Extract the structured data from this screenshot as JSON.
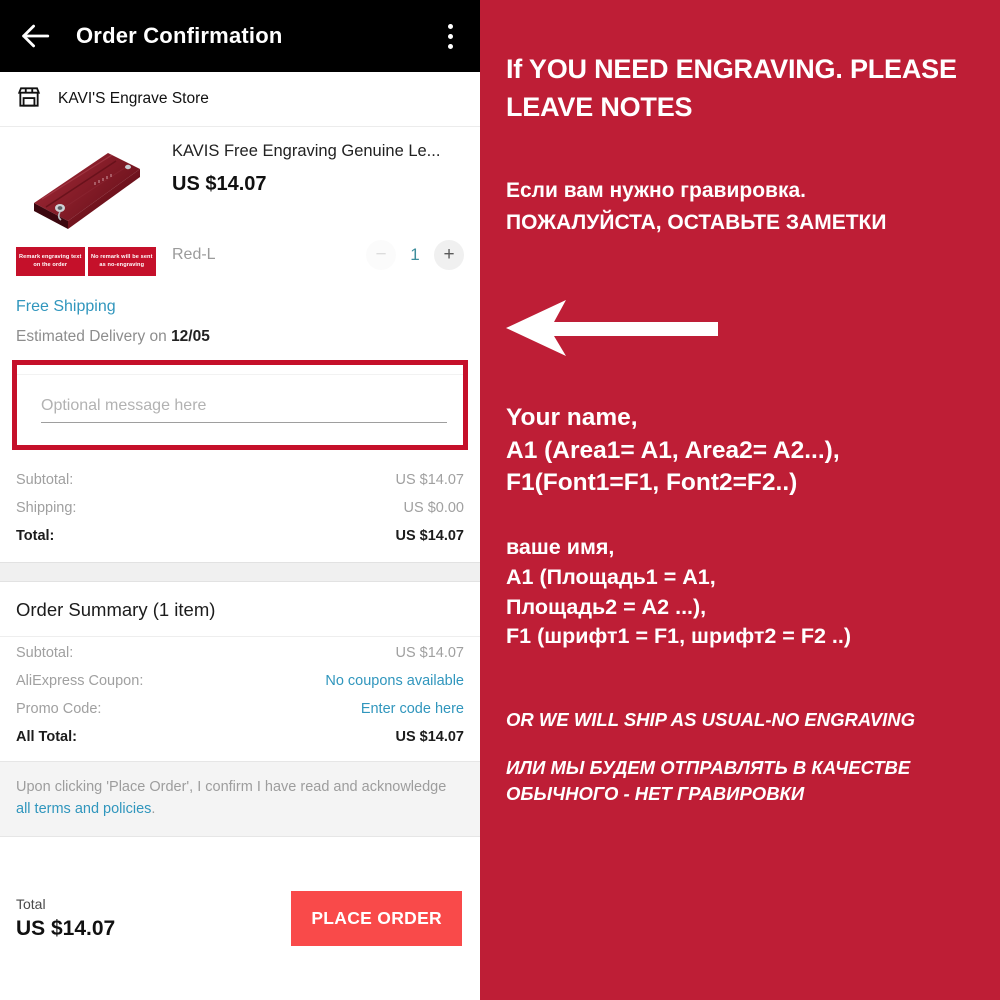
{
  "app": {
    "header": {
      "title": "Order Confirmation",
      "back_icon": "back-arrow-icon",
      "menu_icon": "kebab-menu-icon"
    },
    "store": {
      "icon": "storefront-icon",
      "name": "KAVI'S Engrave Store"
    },
    "product": {
      "title": "KAVIS Free Engraving Genuine Le...",
      "price": "US $14.07",
      "variant": "Red-L",
      "quantity": "1",
      "minus_label": "−",
      "plus_label": "+",
      "badges": [
        "Remark engraving text on the order",
        "No remark will be sent as no-engraving"
      ]
    },
    "shipping": {
      "free_shipping": "Free Shipping",
      "estimated_prefix": "Estimated Delivery on ",
      "estimated_date": "12/05"
    },
    "message": {
      "placeholder": "Optional message here",
      "value": "",
      "highlight_color": "#C5102A"
    },
    "totals": [
      {
        "label": "Subtotal:",
        "value": "US $14.07",
        "strong": false,
        "link": false
      },
      {
        "label": "Shipping:",
        "value": "US $0.00",
        "strong": false,
        "link": false
      },
      {
        "label": "Total:",
        "value": "US $14.07",
        "strong": true,
        "link": false
      }
    ],
    "summary": {
      "title": "Order Summary (1 item)",
      "rows": [
        {
          "label": "Subtotal:",
          "value": "US $14.07",
          "strong": false,
          "link": false
        },
        {
          "label": "AliExpress Coupon:",
          "value": "No coupons available",
          "strong": false,
          "link": true
        },
        {
          "label": "Promo Code:",
          "value": "Enter code here",
          "strong": false,
          "link": true
        },
        {
          "label": "All Total:",
          "value": "US $14.07",
          "strong": true,
          "link": false
        }
      ]
    },
    "terms": {
      "text_before": "Upon clicking 'Place Order', I confirm I have read and acknowledge ",
      "link": "all terms and policies",
      "text_after": "."
    },
    "footer": {
      "total_label": "Total",
      "total_value": "US $14.07",
      "place_order_label": "PLACE ORDER",
      "place_order_color": "#F94A4A"
    }
  },
  "poster": {
    "background_color": "#BE1E36",
    "heading_en": "If YOU NEED ENGRAVING. PLEASE LEAVE NOTES",
    "heading_ru_line1": "Если вам нужно гравировка.",
    "heading_ru_line2": "ПОЖАЛУЙСТА, ОСТАВЬТЕ ЗАМЕТКИ",
    "arrow_icon": "left-arrow-icon",
    "format_en": "Your name,\nA1  (Area1= A1, Area2= A2...),\nF1(Font1=F1, Font2=F2..)",
    "format_ru": "ваше имя,\nA1 (Площадь1 = A1,\nПлощадь2 = A2 ...),\nF1 (шрифт1 = F1, шрифт2 = F2 ..)",
    "note_en": "OR WE WILL SHIP AS USUAL-NO ENGRAVING",
    "note_ru": "ИЛИ МЫ БУДЕМ ОТПРАВЛЯТЬ В КАЧЕСТВЕ ОБЫЧНОГО - НЕТ ГРАВИРОВКИ"
  }
}
